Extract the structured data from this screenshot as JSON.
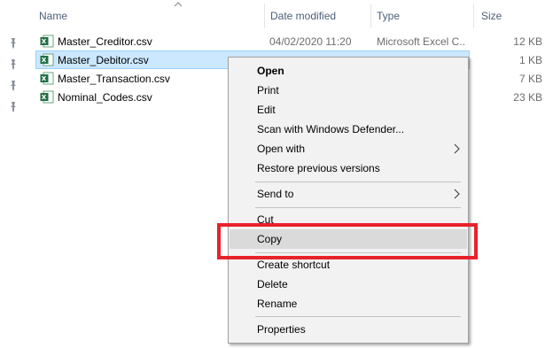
{
  "columns": {
    "name": "Name",
    "date": "Date modified",
    "type": "Type",
    "size": "Size"
  },
  "files": [
    {
      "name": "Master_Creditor.csv",
      "date": "04/02/2020 11:20",
      "type": "Microsoft Excel C...",
      "size": "12 KB",
      "selected": false
    },
    {
      "name": "Master_Debitor.csv",
      "date": "",
      "type": "",
      "size": "1 KB",
      "selected": true
    },
    {
      "name": "Master_Transaction.csv",
      "date": "",
      "type": "",
      "size": "7 KB",
      "selected": false
    },
    {
      "name": "Nominal_Codes.csv",
      "date": "",
      "type": "",
      "size": "23 KB",
      "selected": false
    }
  ],
  "context_menu": {
    "open": "Open",
    "print": "Print",
    "edit": "Edit",
    "scan": "Scan with Windows Defender...",
    "open_with": "Open with",
    "restore": "Restore previous versions",
    "send_to": "Send to",
    "cut": "Cut",
    "copy": "Copy",
    "create_shortcut": "Create shortcut",
    "delete": "Delete",
    "rename": "Rename",
    "properties": "Properties"
  },
  "colors": {
    "selection": "#cce8ff",
    "highlight_border": "#e8212b",
    "excel_green": "#1d6f42"
  },
  "icons": {
    "file": "excel-csv-icon",
    "pin": "pin-icon",
    "submenu": "chevron-right-icon",
    "sort": "sort-up-icon"
  }
}
